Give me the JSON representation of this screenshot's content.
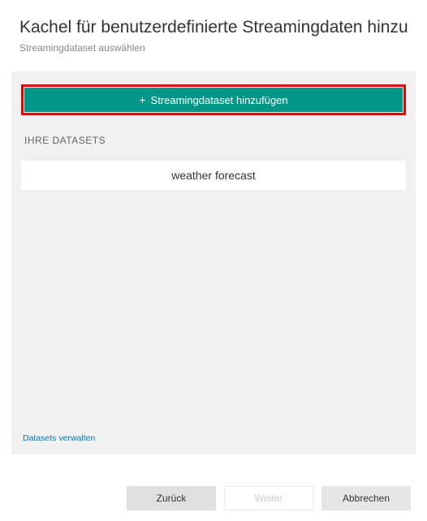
{
  "header": {
    "title": "Kachel für benutzerdefinierte Streamingdaten hinzufügen",
    "subtitle": "Streamingdataset auswählen"
  },
  "content": {
    "add_button_label": "Streamingdataset hinzufügen",
    "section_label": "IHRE DATASETS",
    "datasets": [
      {
        "name": "weather forecast"
      }
    ],
    "manage_link": "Datasets verwalten"
  },
  "footer": {
    "back": "Zurück",
    "next": "Weiter",
    "cancel": "Abbrechen"
  }
}
